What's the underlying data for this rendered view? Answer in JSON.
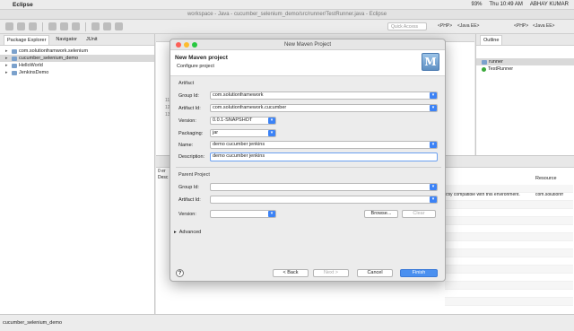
{
  "menubar": {
    "app_name": "Eclipse",
    "battery": "93%",
    "clock": "Thu 10:49 AM",
    "user": "ABHAY KUMAR"
  },
  "window": {
    "title": "workspace - Java - cucumber_selenium_demo/src/runner/TestRunner.java - Eclipse"
  },
  "toolbar": {
    "quick_access": "Quick Access",
    "perspectives": [
      "<PHP>",
      "<Java EE>",
      "<PHP>",
      "<Java EE>"
    ]
  },
  "left_pane": {
    "tabs": [
      "Package Explorer",
      "Navigator",
      "JUnit"
    ],
    "tree": [
      {
        "label": "com.solutionframwork.selenium"
      },
      {
        "label": "cucumber_selenium_demo",
        "selected": true
      },
      {
        "label": "HelloWorld"
      },
      {
        "label": "JenkinsDemo"
      }
    ]
  },
  "right_pane": {
    "tab": "Outline",
    "items": [
      "runner",
      "TestRunner"
    ]
  },
  "editor": {
    "line_numbers": [
      "1",
      "2",
      "3",
      "4",
      "5",
      "6",
      "7",
      "8",
      "9",
      "10",
      "11",
      "12",
      "13"
    ]
  },
  "bottom_pane": {
    "column_resource": "Resource",
    "message_fragment": "ctly compatible with this environment.",
    "resource_value": "com.solutionfr",
    "prefixes": [
      "0 er",
      "Desc"
    ]
  },
  "status_bar": {
    "text": "cucumber_selenium_demo"
  },
  "dialog": {
    "title": "New Maven Project",
    "header_title": "New Maven project",
    "header_subtitle": "Configure project",
    "artifact_section": "Artifact",
    "group_id_label": "Group Id:",
    "group_id_value": "com.solutionframework",
    "artifact_id_label": "Artifact Id:",
    "artifact_id_value": "com.solutionframework.cucumber",
    "version_label": "Version:",
    "version_value": "0.0.1-SNAPSHOT",
    "packaging_label": "Packaging:",
    "packaging_value": "jar",
    "name_label": "Name:",
    "name_value": "demo cucumber jenkins",
    "description_label": "Description:",
    "description_value": "demo cucumber jenkins",
    "parent_section": "Parent Project",
    "parent_group_id_label": "Group Id:",
    "parent_artifact_id_label": "Artifact Id:",
    "parent_version_label": "Version:",
    "browse_label": "Browse...",
    "clear_label": "Clear",
    "advanced_label": "Advanced",
    "back_label": "< Back",
    "next_label": "Next >",
    "cancel_label": "Cancel",
    "finish_label": "Finish",
    "help_label": "?",
    "logo_letter": "M"
  },
  "colors": {
    "accent": "#3b82f6",
    "finish_button": "#4a90f0"
  }
}
